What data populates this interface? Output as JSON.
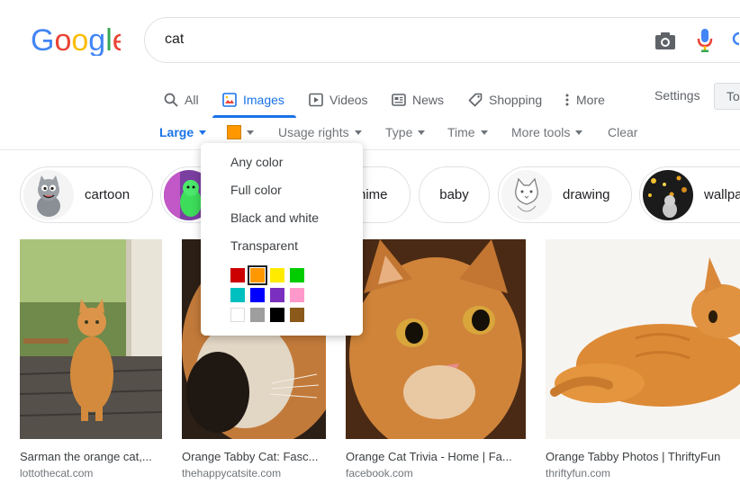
{
  "logo": {
    "letters": [
      "G",
      "o",
      "o",
      "g",
      "l",
      "e"
    ],
    "colors": [
      "#4285F4",
      "#EA4335",
      "#FBBC05",
      "#4285F4",
      "#34A853",
      "#EA4335"
    ]
  },
  "search": {
    "value": "cat"
  },
  "icons": {
    "camera": "camera-icon",
    "mic": "microphone-icon"
  },
  "tabs": [
    {
      "label": "All",
      "icon": "search-icon",
      "active": false
    },
    {
      "label": "Images",
      "icon": "image-icon",
      "active": true
    },
    {
      "label": "Videos",
      "icon": "video-icon",
      "active": false
    },
    {
      "label": "News",
      "icon": "news-icon",
      "active": false
    },
    {
      "label": "Shopping",
      "icon": "tag-icon",
      "active": false
    },
    {
      "label": "More",
      "icon": "more-dots-icon",
      "active": false
    }
  ],
  "settings_label": "Settings",
  "tools_label": "To",
  "filters": {
    "size": "Large",
    "color_selected": "#ff9800",
    "usage": "Usage rights",
    "type": "Type",
    "time": "Time",
    "more_tools": "More tools",
    "clear": "Clear"
  },
  "chips": [
    {
      "label": "cartoon"
    },
    {
      "label": ""
    },
    {
      "label": "nime"
    },
    {
      "label": "baby"
    },
    {
      "label": "drawing"
    },
    {
      "label": "wallpa"
    }
  ],
  "dropdown": {
    "options": [
      "Any color",
      "Full color",
      "Black and white",
      "Transparent"
    ],
    "swatches": [
      "#cc0000",
      "#ff9800",
      "#ffeb00",
      "#00cc00",
      "#00bfbf",
      "#0000ff",
      "#7b2fbe",
      "#ff99cc",
      "#ffffff",
      "#9e9e9e",
      "#000000",
      "#8b5a1b"
    ],
    "selected": "#ff9800"
  },
  "results": [
    {
      "title": "Sarman the orange cat,...",
      "site": "lottothecat.com"
    },
    {
      "title": "Orange Tabby Cat: Fasc...",
      "site": "thehappycatsite.com"
    },
    {
      "title": "Orange Cat Trivia - Home | Fa...",
      "site": "facebook.com"
    },
    {
      "title": "Orange Tabby Photos | ThriftyFun",
      "site": "thriftyfun.com"
    }
  ]
}
